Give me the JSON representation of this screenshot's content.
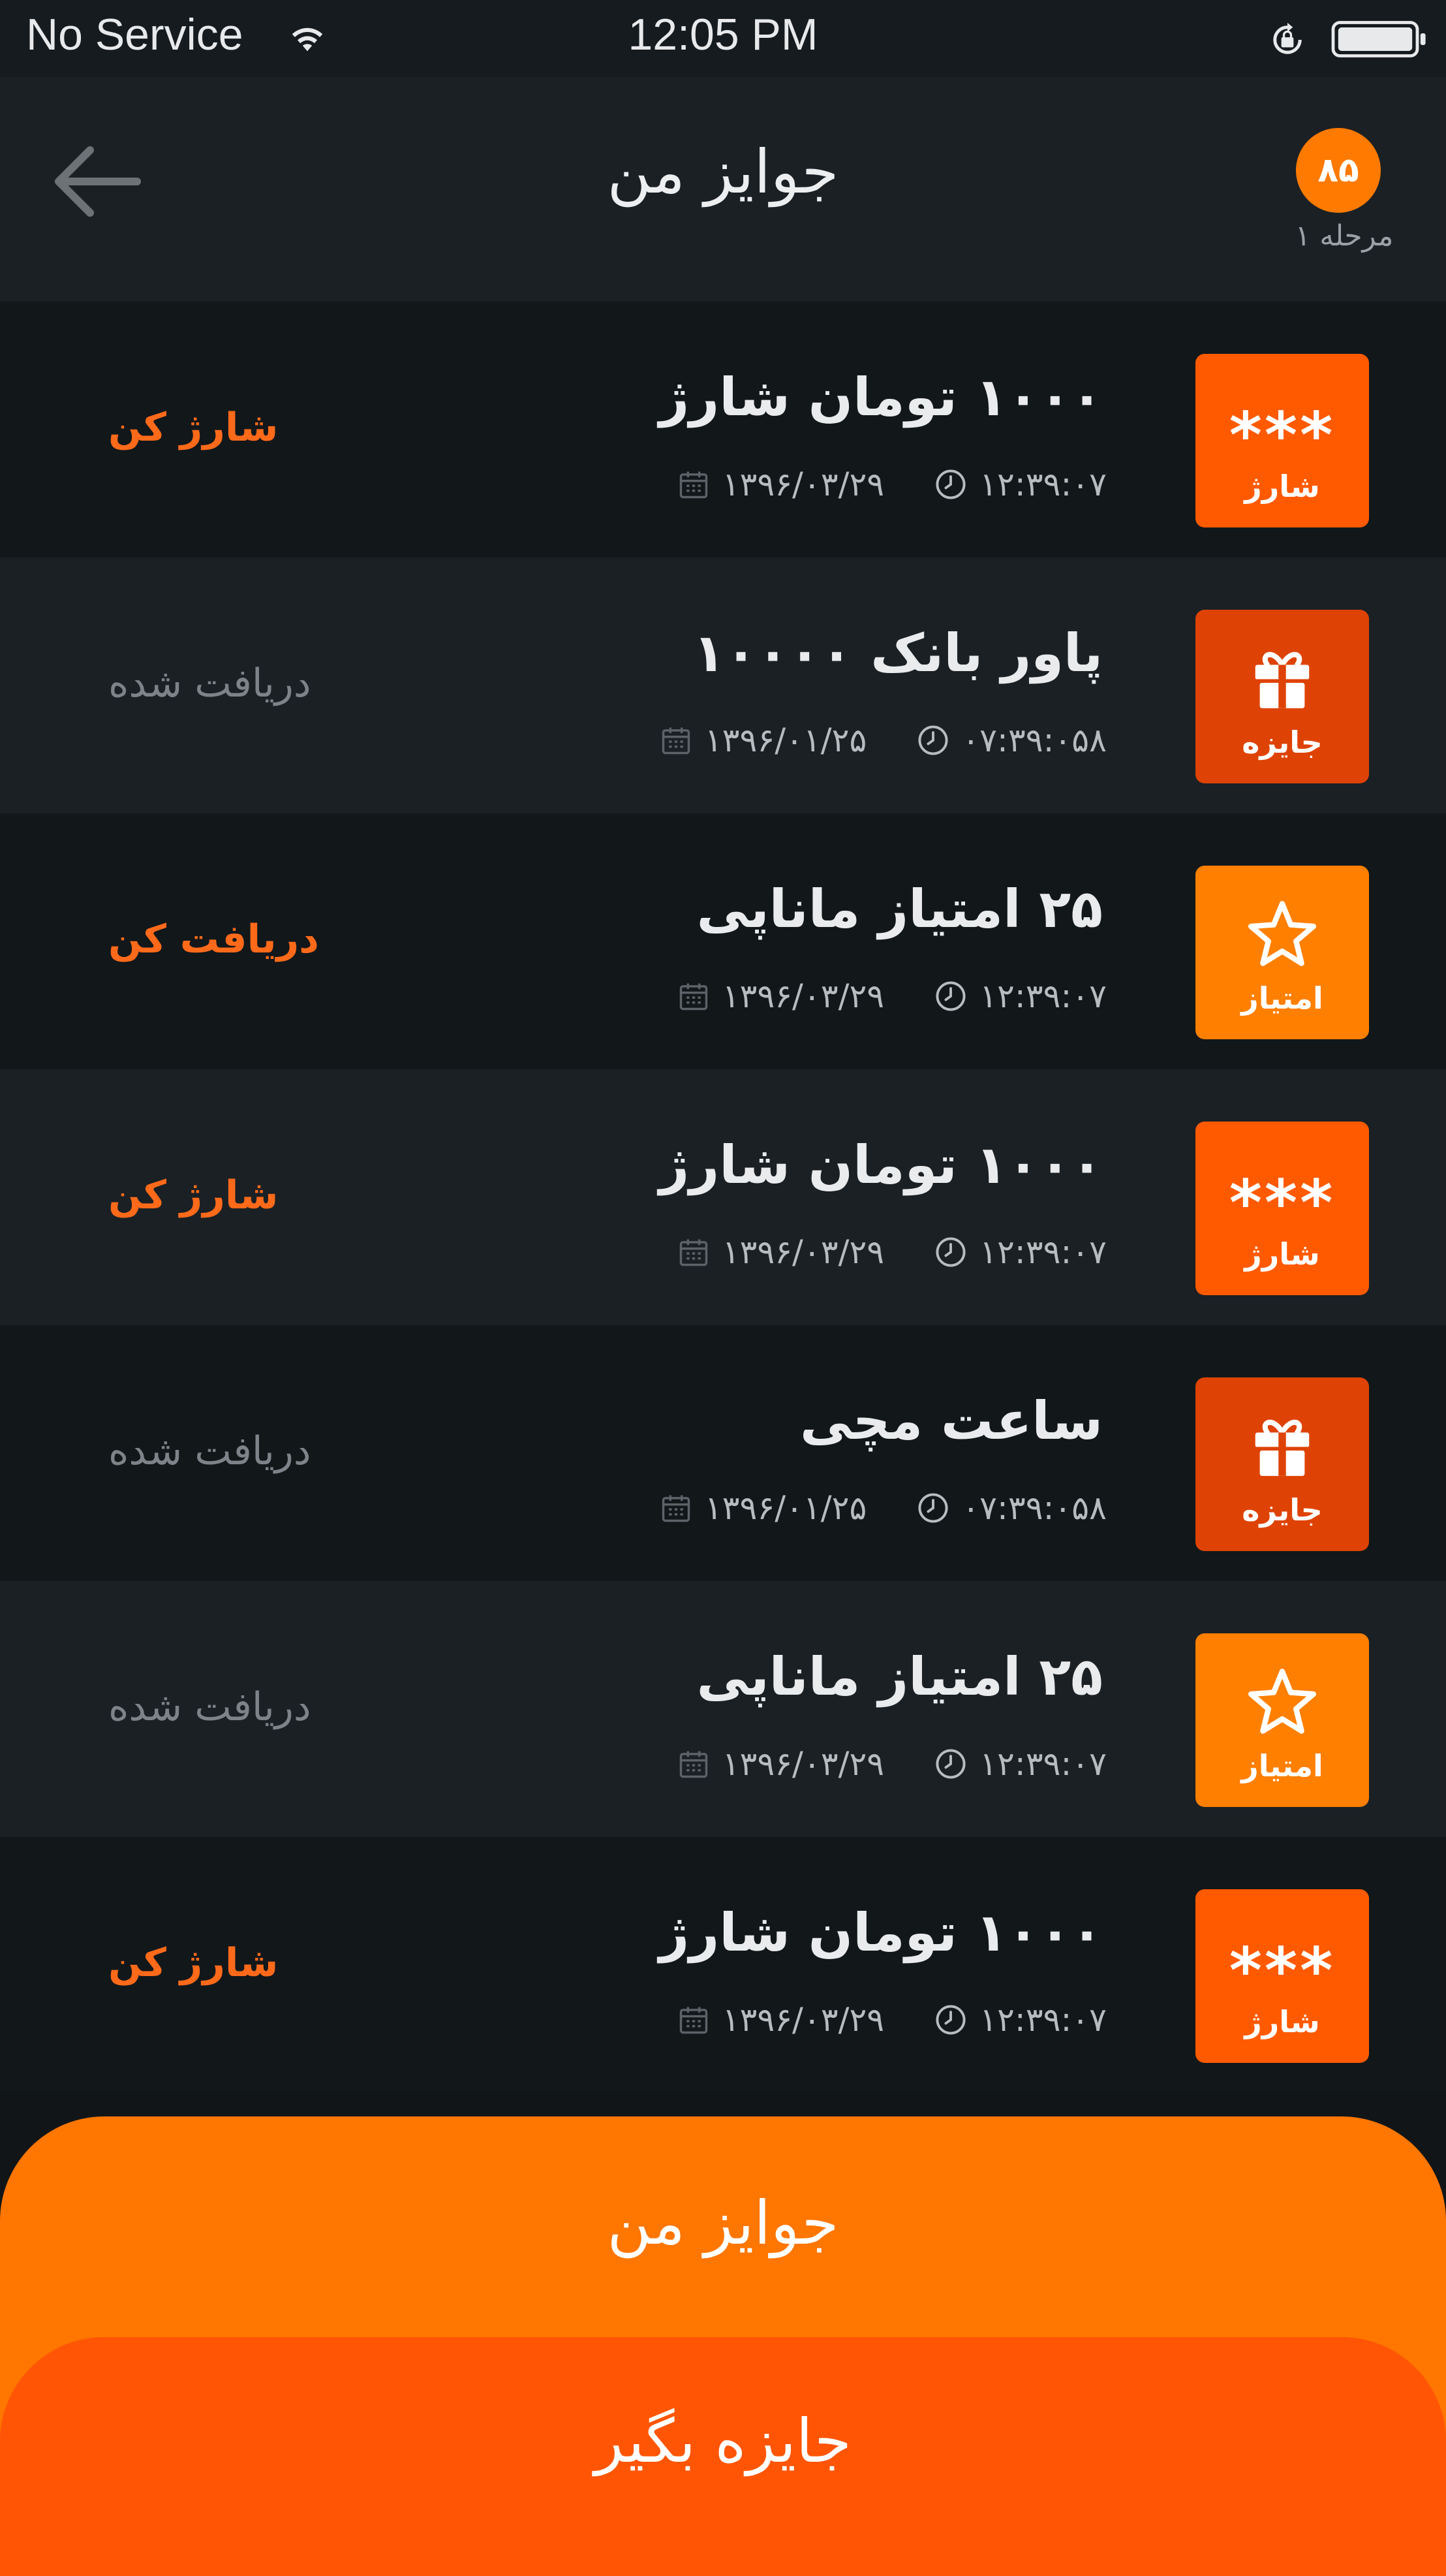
{
  "status_bar": {
    "carrier": "No Service",
    "time": "12:05 PM",
    "icons": [
      "wifi-icon",
      "rotation-lock-icon",
      "battery-icon"
    ]
  },
  "header": {
    "title": "جوایز من",
    "back_icon": "arrow-left-icon",
    "level_badge": "۸۵",
    "level_label": "مرحله ۱"
  },
  "colors": {
    "accent": "#ff7600",
    "charge_tile": "#ff5a00",
    "gift_tile": "#de4305",
    "point_tile": "#ff7f00",
    "action_active": "#ff6a1a",
    "action_done": "#7d8388"
  },
  "prizes": [
    {
      "kind": "charge",
      "tile_symbol": "***",
      "tile_label": "شارژ",
      "tile_color": "#ff5a00",
      "title": "۱۰۰۰ تومان شارژ",
      "date": "۱۳۹۶/۰۳/۲۹",
      "time": "۱۲:۳۹:۰۷",
      "action": "شارژ کن",
      "action_state": "active"
    },
    {
      "kind": "gift",
      "tile_symbol": "gift-icon",
      "tile_label": "جایزه",
      "tile_color": "#de4305",
      "title": "پاور بانک ۱۰۰۰۰",
      "date": "۱۳۹۶/۰۱/۲۵",
      "time": "۰۷:۳۹:۰۵۸",
      "action": "دریافت شده",
      "action_state": "done"
    },
    {
      "kind": "points",
      "tile_symbol": "star-icon",
      "tile_label": "امتیاز",
      "tile_color": "#ff7f00",
      "title": "۲۵ امتیاز ماناپی",
      "date": "۱۳۹۶/۰۳/۲۹",
      "time": "۱۲:۳۹:۰۷",
      "action": "دریافت کن",
      "action_state": "active"
    },
    {
      "kind": "charge",
      "tile_symbol": "***",
      "tile_label": "شارژ",
      "tile_color": "#ff5a00",
      "title": "۱۰۰۰ تومان شارژ",
      "date": "۱۳۹۶/۰۳/۲۹",
      "time": "۱۲:۳۹:۰۷",
      "action": "شارژ کن",
      "action_state": "active"
    },
    {
      "kind": "gift",
      "tile_symbol": "gift-icon",
      "tile_label": "جایزه",
      "tile_color": "#de4305",
      "title": "ساعت مچی",
      "date": "۱۳۹۶/۰۱/۲۵",
      "time": "۰۷:۳۹:۰۵۸",
      "action": "دریافت شده",
      "action_state": "done"
    },
    {
      "kind": "points",
      "tile_symbol": "star-icon",
      "tile_label": "امتیاز",
      "tile_color": "#ff7f00",
      "title": "۲۵ امتیاز ماناپی",
      "date": "۱۳۹۶/۰۳/۲۹",
      "time": "۱۲:۳۹:۰۷",
      "action": "دریافت شده",
      "action_state": "done"
    },
    {
      "kind": "charge",
      "tile_symbol": "***",
      "tile_label": "شارژ",
      "tile_color": "#ff5a00",
      "title": "۱۰۰۰ تومان شارژ",
      "date": "۱۳۹۶/۰۳/۲۹",
      "time": "۱۲:۳۹:۰۷",
      "action": "شارژ کن",
      "action_state": "active"
    }
  ],
  "bottom": {
    "my_prizes_label": "جوایز من",
    "get_prize_label": "جایزه بگیر"
  }
}
